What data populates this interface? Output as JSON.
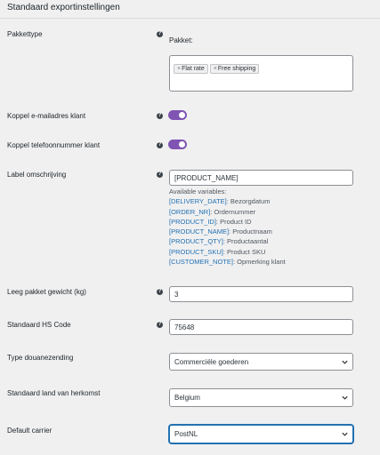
{
  "title": "Standaard exportinstellingen",
  "rows": {
    "pakkettype": {
      "label": "Pakkettype",
      "sublabel": "Pakket:",
      "tags": [
        "Flat rate",
        "Free shipping"
      ]
    },
    "email": {
      "label": "Koppel e-mailadres klant",
      "enabled": true
    },
    "phone": {
      "label": "Koppel telefoonnummer klant",
      "enabled": true
    },
    "label_desc": {
      "label": "Label omschrijving",
      "value": "[PRODUCT_NAME]",
      "vars_title": "Available variables:",
      "vars": [
        {
          "key": "[DELIVERY_DATE]",
          "desc": ": Bezorgdatum"
        },
        {
          "key": "[ORDER_NR]",
          "desc": ": Ordernummer"
        },
        {
          "key": "[PRODUCT_ID]",
          "desc": ": Product ID"
        },
        {
          "key": "[PRODUCT_NAME]",
          "desc": ": Productnaam"
        },
        {
          "key": "[PRODUCT_QTY]",
          "desc": ": Productaantal"
        },
        {
          "key": "[PRODUCT_SKU]",
          "desc": ": Product SKU"
        },
        {
          "key": "[CUSTOMER_NOTE]",
          "desc": ": Opmerking klant"
        }
      ]
    },
    "weight": {
      "label": "Leeg pakket gewicht (kg)",
      "value": "3"
    },
    "hs": {
      "label": "Standaard HS Code",
      "value": "75648"
    },
    "customs": {
      "label": "Type douanezending",
      "value": "Commerciële goederen"
    },
    "origin": {
      "label": "Standaard land van herkomst",
      "value": "Belgium"
    },
    "carrier": {
      "label": "Default carrier",
      "value": "PostNL"
    }
  },
  "colors": {
    "toggle": "#7f54b3",
    "link": "#2271b1",
    "focus": "#2271b1"
  },
  "icons": {
    "help": "question-circle-icon",
    "remove": "times-icon",
    "dropdown": "chevron-down-icon"
  }
}
